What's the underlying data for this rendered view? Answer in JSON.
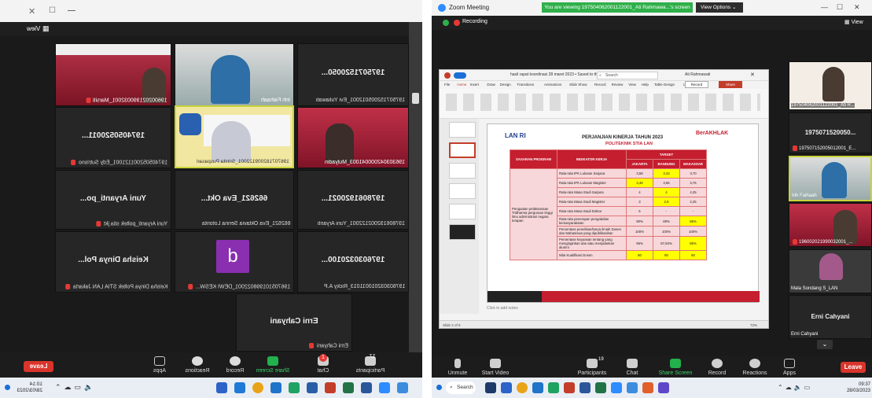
{
  "left": {
    "view_label": "View",
    "tiles": [
      {
        "name": "",
        "label": "196002021990032001_Marsiti"
      },
      {
        "name": "",
        "label": "Irih Faihaah"
      },
      {
        "name": "1975071520050...",
        "label": "197507152005012001_Evi Yuliawati"
      },
      {
        "name": "1974050520011...",
        "label": "197405052001121001_Edy Sutrisno"
      },
      {
        "name": "",
        "label": "196707182009122001_Srinita Puspasari"
      },
      {
        "name": "",
        "label": "196303042000041003_Mulyadin"
      },
      {
        "name": "Yuni Aryanti_po...",
        "label": "Yuni Aryanti_poltek stia jkt"
      },
      {
        "name": "662621_Eva Okt...",
        "label": "662621_Eva Oktavia Senna Lotonta"
      },
      {
        "name": "1978061920021...",
        "label": "197806192002122001_Yuni Aryanti"
      },
      {
        "name": "Keisha Dinya Pol...",
        "label": "Keisha Dinya Poltek STIA LAN Jakarta"
      },
      {
        "name": "b",
        "label": "196705101998022001_DEWI KESW..."
      },
      {
        "name": "1976030320100...",
        "label": "197603032010011013_Ricky A.P"
      },
      {
        "name": "Erni Cahyani",
        "label": "Erni Cahyani"
      }
    ],
    "toolbar": [
      "Apps",
      "Reactions",
      "Record",
      "Share Screen",
      "Chat",
      "Participants"
    ],
    "leave": "Leave",
    "chat_badge": "1",
    "participants_count": "17",
    "clock_time": "10:14",
    "clock_date": "28/03/2023"
  },
  "right": {
    "title": "Zoom Meeting",
    "banner": "You are viewing 197504062001122001_Ati Rahmawa...'s screen",
    "view_options": "View Options",
    "view": "View",
    "recording": "Recording",
    "ppt_filename": "hasil rapat koordinasi 28 maret 2023 • Saved to this PC",
    "ppt_search": "Search",
    "ppt_user": "Ati Rahmawati",
    "ppt_tabs": [
      "File",
      "Home",
      "Insert",
      "Draw",
      "Design",
      "Transitions",
      "Animations",
      "Slide Show",
      "Record",
      "Review",
      "View",
      "Help",
      "Table Design",
      "Layout"
    ],
    "ppt_record": "Record",
    "ppt_share": "Share",
    "ppt_notes": "Click to add notes",
    "ppt_status": "Slide 2 of 9",
    "ppt_zoom": "72%",
    "slide": {
      "logo": "LAN RI",
      "title": "PERJANJIAN KINERJA TAHUN 2023",
      "subtitle": "POLITEKNIK STIA LAN",
      "brand": "BerAKHLAK",
      "head": [
        "SASARAN PROGRAM",
        "INDIKATOR KERJA",
        "TARGET",
        "JAKARTA",
        "BANDUNG",
        "MAKASSAR"
      ],
      "sasaran": "Penguatan pelaksanaan Tridharma perguruan tinggi ilmu administrasi negara terapan",
      "rows": [
        [
          "Rata-rata IPK Lulusan Sarjana",
          "3,58",
          "3,43",
          "3,70"
        ],
        [
          "Rata-rata IPK Lulusan Magister",
          "3,48",
          "3,55",
          "3,76"
        ],
        [
          "Rata-rata Masa Studi Sarjana",
          "4",
          "4",
          "4,25"
        ],
        [
          "Rata-rata Masa Studi Magister",
          "3",
          "2,5",
          "2,25"
        ],
        [
          "Rata-rata Masa Studi Doktor",
          "5",
          "-",
          "-"
        ],
        [
          "Rata-rata penerapan pengabdian kemasyarakatan",
          "90%",
          "89%",
          "85%"
        ],
        [
          "Persentase penelitian/karya ilmiah Dosen dan Mahasiswa yang dipublikasikan",
          "100%",
          "100%",
          "100%"
        ],
        [
          "Persentase kepuasan tentang yang menginginkan dan atau menjalankan alumni",
          "95%",
          "87,50%",
          "85%"
        ],
        [
          "Nilai Kualifikasi Dosen",
          "80",
          "80",
          "80"
        ]
      ]
    },
    "side": [
      {
        "name": "",
        "label": "197504062001122001_Ati R..."
      },
      {
        "name": "1975071520050...",
        "label": "197507152005012001_E..."
      },
      {
        "name": "",
        "label": "Irih Faihaah"
      },
      {
        "name": "",
        "label": "196002021990032001_..."
      },
      {
        "name": "",
        "label": "Mala Sondang S_LAN"
      },
      {
        "name": "Erni Cahyani",
        "label": "Erni Cahyani"
      }
    ],
    "toolbar": [
      "Unmute",
      "Start Video",
      "Participants",
      "Chat",
      "Share Screen",
      "Record",
      "Reactions",
      "Apps"
    ],
    "participants_count": "19",
    "leave": "Leave",
    "search": "Search",
    "clock_time": "09:37",
    "clock_date": "28/03/2023"
  }
}
